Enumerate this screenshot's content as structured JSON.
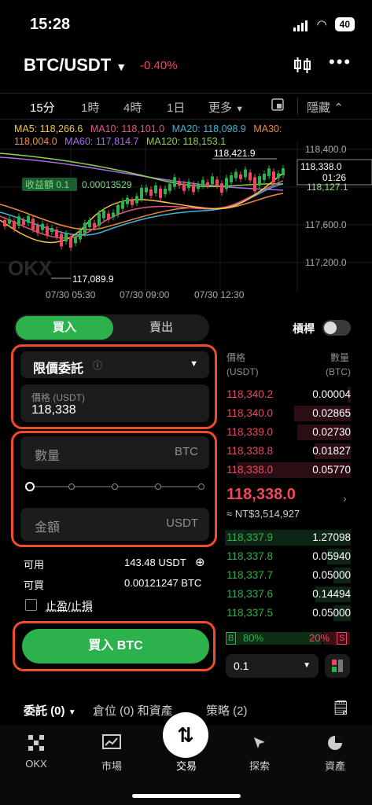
{
  "status": {
    "time": "15:28",
    "battery": "40"
  },
  "header": {
    "pair": "BTC/USDT",
    "change": "-0.40%"
  },
  "timeframes": {
    "tf15": "15分",
    "tf1h": "1時",
    "tf4h": "4時",
    "tf1d": "1日",
    "more": "更多",
    "hide": "隱藏"
  },
  "ma": {
    "ma5": "MA5: 118,266.6",
    "ma10": "MA10: 118,101.0",
    "ma20": "MA20: 118,098.9",
    "ma30": "MA30:",
    "ma30v": "118,004.0",
    "ma60": "MA60: 117,814.7",
    "ma120": "MA120: 118,153.1"
  },
  "chart_data": {
    "type": "candlestick",
    "y_ticks": [
      "118,400.0",
      "117,600.0",
      "117,200.0"
    ],
    "x_ticks": [
      "07/30 05:30",
      "07/30 09:00",
      "07/30 12:30"
    ],
    "high_label": "118,421.9",
    "low_label": "117,089.9",
    "last_price": "118,338.0",
    "countdown": "01:26",
    "profit_label": "收益額 0.1",
    "profit_value": "0.00013529",
    "ma_line_label": "118,127.1",
    "watermark": "OKX"
  },
  "trade": {
    "buy": "買入",
    "sell": "賣出",
    "leverage": "槓桿",
    "order_type": "限價委託",
    "price_label": "價格 (USDT)",
    "price_value": "118,338",
    "qty_placeholder": "數量",
    "qty_unit": "BTC",
    "amount_placeholder": "金額",
    "amount_unit": "USDT",
    "available_label": "可用",
    "available_value": "143.48 USDT",
    "buyable_label": "可買",
    "buyable_value": "0.00121247 BTC",
    "tpsl": "止盈/止損",
    "submit": "買入 BTC"
  },
  "orderbook": {
    "price_header": "價格",
    "price_unit": "(USDT)",
    "qty_header": "數量",
    "qty_unit": "(BTC)",
    "asks": [
      {
        "price": "118,340.2",
        "qty": "0.00004"
      },
      {
        "price": "118,340.0",
        "qty": "0.02865"
      },
      {
        "price": "118,339.0",
        "qty": "0.02730"
      },
      {
        "price": "118,338.8",
        "qty": "0.01827"
      },
      {
        "price": "118,338.0",
        "qty": "0.05770"
      }
    ],
    "last": "118,338.0",
    "fiat": "≈ NT$3,514,927",
    "bids": [
      {
        "price": "118,337.9",
        "qty": "1.27098"
      },
      {
        "price": "118,337.8",
        "qty": "0.05940"
      },
      {
        "price": "118,337.7",
        "qty": "0.05000"
      },
      {
        "price": "118,337.6",
        "qty": "0.14494"
      },
      {
        "price": "118,337.5",
        "qty": "0.05000"
      }
    ],
    "b_label": "B",
    "b_pct": "80%",
    "s_pct": "20%",
    "s_label": "S",
    "depth": "0.1"
  },
  "bottom": {
    "orders": "委託 (0)",
    "positions": "倉位 (0) 和資產",
    "strategy": "策略 (2)"
  },
  "tabbar": {
    "okx": "OKX",
    "market": "市場",
    "trade": "交易",
    "explore": "探索",
    "assets": "資產"
  }
}
